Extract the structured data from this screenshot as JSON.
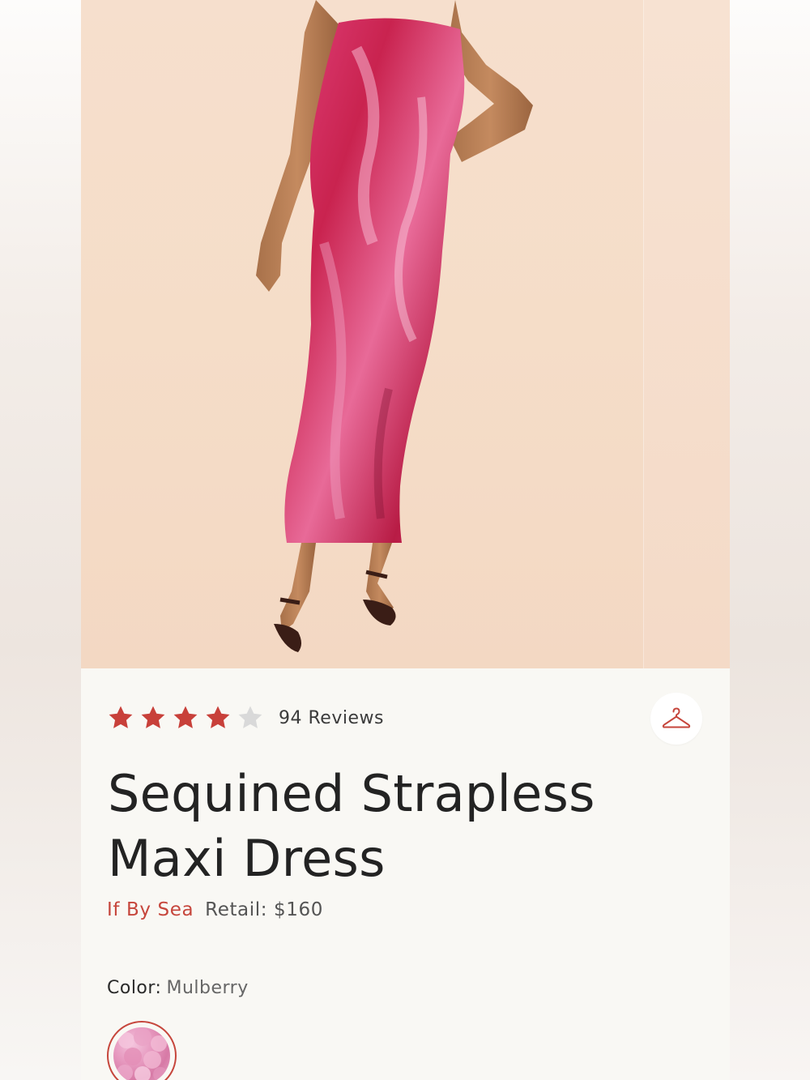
{
  "product": {
    "rating": 4,
    "rating_max": 5,
    "reviews_label": "94 Reviews",
    "title_line1": "Sequined Strapless",
    "title_line2": "Maxi Dress",
    "brand": "If By Sea",
    "retail": "Retail: $160",
    "color_label": "Color:",
    "color_value": "Mulberry"
  },
  "icons": {
    "star_filled": "star-icon",
    "star_empty": "star-empty-icon",
    "hanger": "hanger-icon"
  },
  "colors": {
    "accent": "#c6463c",
    "star_filled": "#c8403a",
    "star_empty": "#d9d9d9",
    "title_text": "#232323",
    "dress": "#c9234f"
  }
}
